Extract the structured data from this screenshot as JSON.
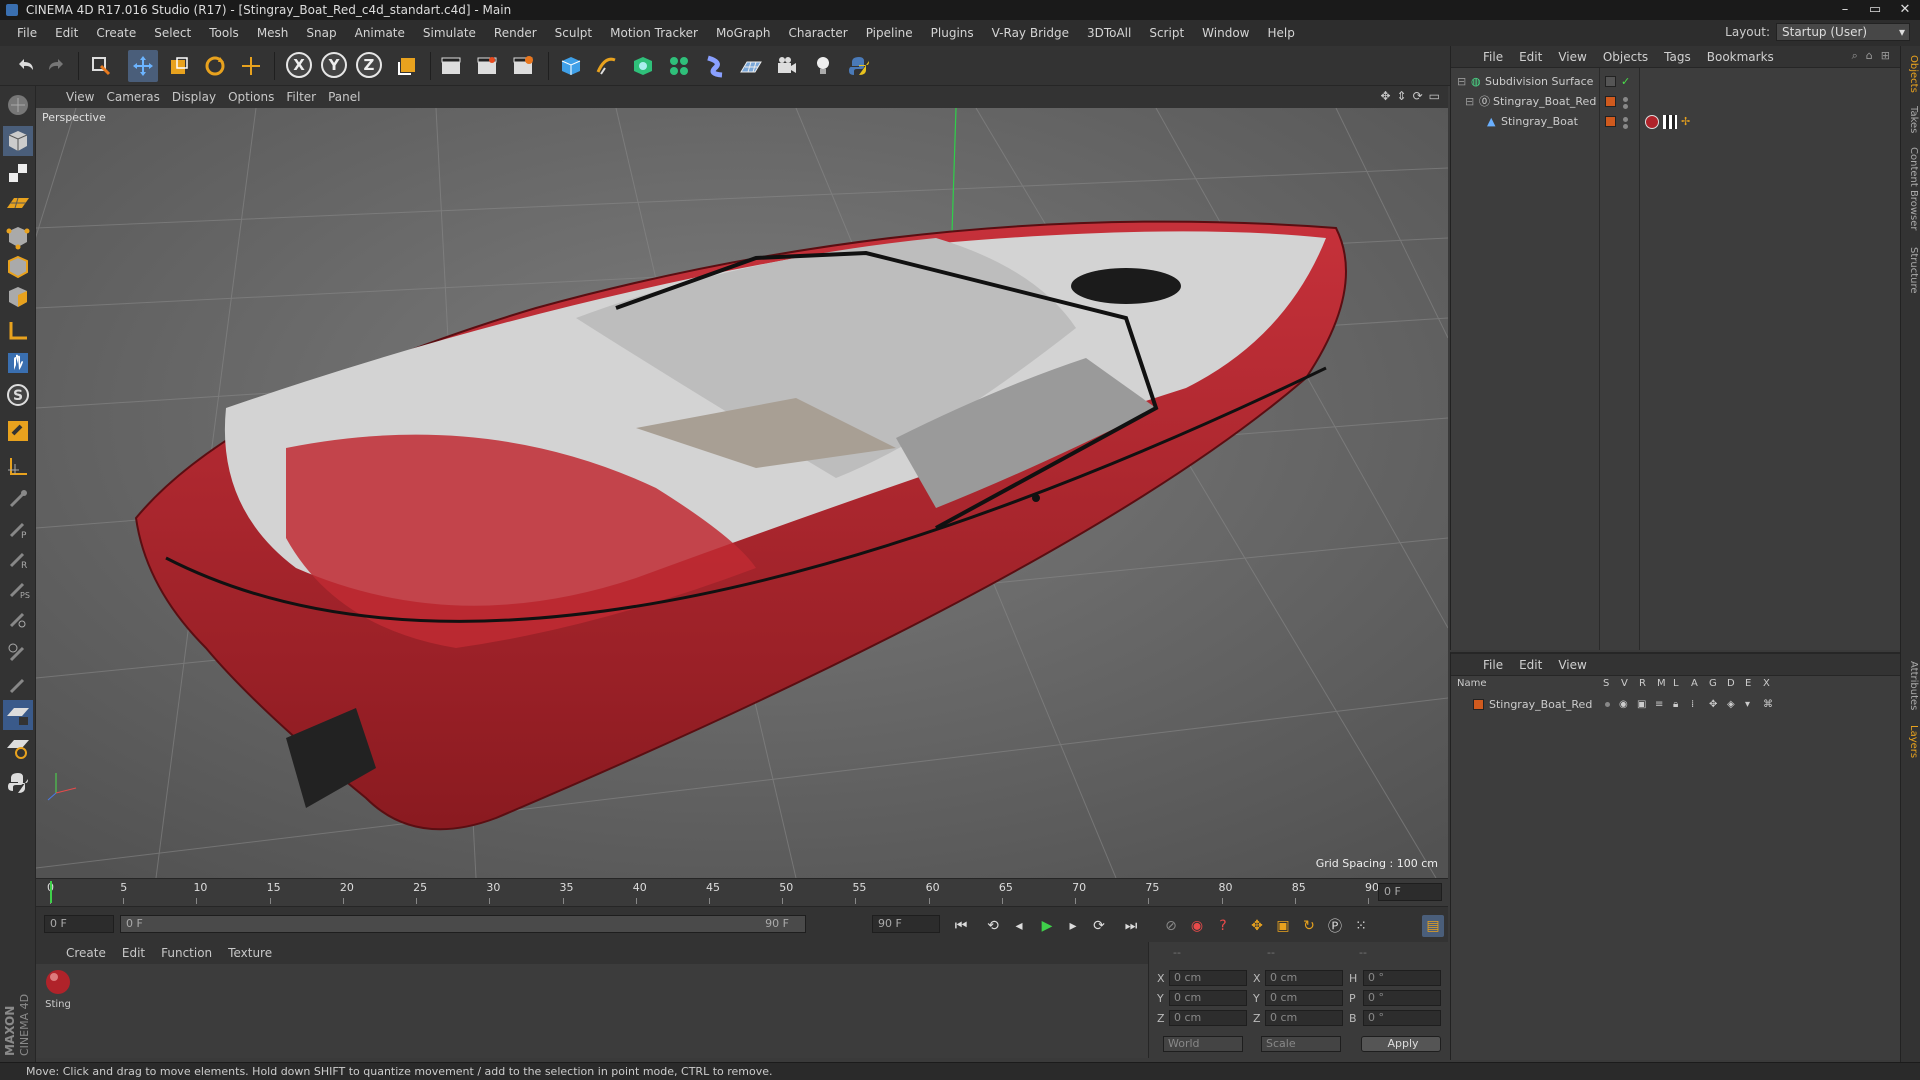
{
  "window": {
    "title": "CINEMA 4D R17.016 Studio (R17) - [Stingray_Boat_Red_c4d_standart.c4d] - Main",
    "controls": [
      "–",
      "▭",
      "✕"
    ]
  },
  "menu": [
    "File",
    "Edit",
    "Create",
    "Select",
    "Tools",
    "Mesh",
    "Snap",
    "Animate",
    "Simulate",
    "Render",
    "Sculpt",
    "Motion Tracker",
    "MoGraph",
    "Character",
    "Pipeline",
    "Plugins",
    "V-Ray Bridge",
    "3DToAll",
    "Script",
    "Window",
    "Help"
  ],
  "layout": {
    "label": "Layout:",
    "value": "Startup (User)"
  },
  "toolbar": {
    "axis_x": "X",
    "axis_y": "Y",
    "axis_z": "Z"
  },
  "viewport": {
    "menu": [
      "View",
      "Cameras",
      "Display",
      "Options",
      "Filter",
      "Panel"
    ],
    "label": "Perspective",
    "grid_spacing": "Grid Spacing : 100 cm"
  },
  "timeline": {
    "ticks": [
      "0",
      "5",
      "10",
      "15",
      "20",
      "25",
      "30",
      "35",
      "40",
      "45",
      "50",
      "55",
      "60",
      "65",
      "70",
      "75",
      "80",
      "85",
      "90"
    ],
    "end_field": "0 F",
    "current_frame": "0 F",
    "range_start": "0 F",
    "range_end": "90 F",
    "max_frame": "90 F"
  },
  "materials": {
    "menu": [
      "Create",
      "Edit",
      "Function",
      "Texture"
    ],
    "items": [
      {
        "name": "Sting"
      }
    ]
  },
  "coords": {
    "headers": [
      "--",
      "--",
      "--"
    ],
    "rows": [
      {
        "a": "X",
        "av": "0 cm",
        "b": "X",
        "bv": "0 cm",
        "c": "H",
        "cv": "0 °"
      },
      {
        "a": "Y",
        "av": "0 cm",
        "b": "Y",
        "bv": "0 cm",
        "c": "P",
        "cv": "0 °"
      },
      {
        "a": "Z",
        "av": "0 cm",
        "b": "Z",
        "bv": "0 cm",
        "c": "B",
        "cv": "0 °"
      }
    ],
    "mode1": "World",
    "mode2": "Scale",
    "apply": "Apply"
  },
  "objects_panel": {
    "menu": [
      "File",
      "Edit",
      "View",
      "Objects",
      "Tags",
      "Bookmarks"
    ],
    "items": [
      {
        "name": "Subdivision Surface"
      },
      {
        "name": "Stingray_Boat_Red"
      },
      {
        "name": "Stingray_Boat"
      }
    ]
  },
  "layers_panel": {
    "menu": [
      "File",
      "Edit",
      "View"
    ],
    "columns": [
      "Name",
      "S",
      "V",
      "R",
      "M",
      "L",
      "A",
      "G",
      "D",
      "E",
      "X"
    ],
    "items": [
      {
        "name": "Stingray_Boat_Red"
      }
    ]
  },
  "right_tabs": [
    "Objects",
    "Takes",
    "Content Browser",
    "Structure",
    "Attributes",
    "Layers"
  ],
  "branding": {
    "maxon": "MAXON",
    "cinema": "CINEMA 4D"
  },
  "status": "Move: Click and drag to move elements. Hold down SHIFT to quantize movement / add to the selection in point mode, CTRL to remove.",
  "colors": {
    "accent": "#d05a1e",
    "boat_red": "#b0232a",
    "viewport_bg": "#6c6c6c"
  }
}
